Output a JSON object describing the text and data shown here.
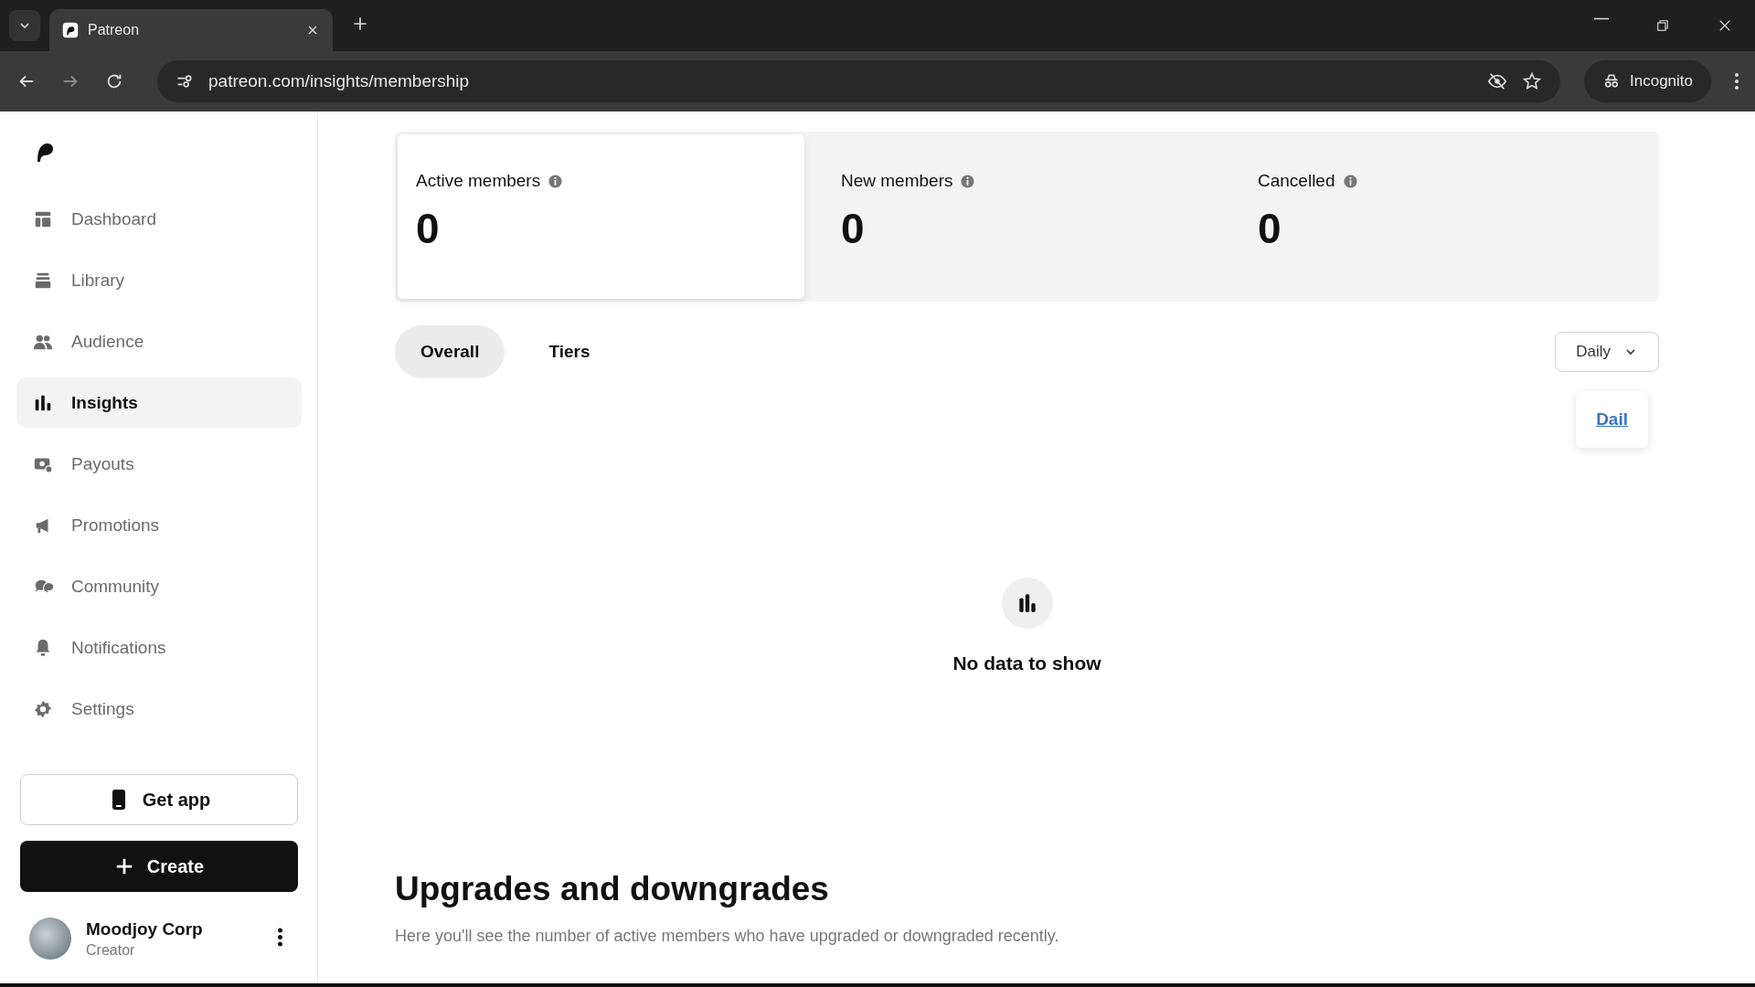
{
  "browser": {
    "tabs": [
      {
        "title": "Patreon",
        "selected": true
      }
    ],
    "url": "patreon.com/insights/membership",
    "profile": "Incognito"
  },
  "sidebar": {
    "items": [
      {
        "label": "Dashboard",
        "selected": false
      },
      {
        "label": "Library",
        "selected": false
      },
      {
        "label": "Audience",
        "selected": false
      },
      {
        "label": "Insights",
        "selected": true
      },
      {
        "label": "Payouts",
        "selected": false
      },
      {
        "label": "Promotions",
        "selected": false
      },
      {
        "label": "Community",
        "selected": false
      },
      {
        "label": "Notifications",
        "selected": false
      },
      {
        "label": "Settings",
        "selected": false
      }
    ],
    "get_app": "Get app",
    "create": "Create",
    "user": {
      "name": "Moodjoy Corp",
      "role": "Creator"
    }
  },
  "stats": [
    {
      "label": "Active members",
      "value": "0",
      "selected": true
    },
    {
      "label": "New members",
      "value": "0",
      "selected": false
    },
    {
      "label": "Cancelled",
      "value": "0",
      "selected": false
    }
  ],
  "tabs": [
    {
      "label": "Overall",
      "selected": true
    },
    {
      "label": "Tiers",
      "selected": false
    }
  ],
  "period": {
    "value": "Daily",
    "menu_option": "Dail"
  },
  "empty_state": "No data to show",
  "section": {
    "title": "Upgrades and downgrades",
    "description": "Here you'll see the number of active members who have upgraded or downgraded recently."
  }
}
